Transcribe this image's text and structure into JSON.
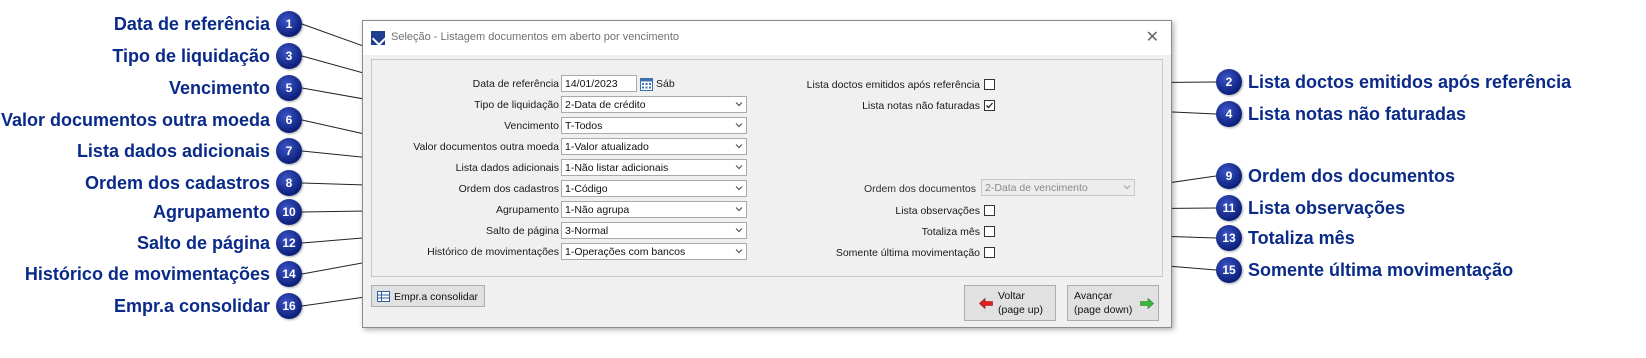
{
  "callouts": [
    {
      "num": "1",
      "text": "Data de referência"
    },
    {
      "num": "3",
      "text": "Tipo de liquidação"
    },
    {
      "num": "5",
      "text": "Vencimento"
    },
    {
      "num": "6",
      "text": "Valor documentos outra moeda"
    },
    {
      "num": "7",
      "text": "Lista dados adicionais"
    },
    {
      "num": "8",
      "text": "Ordem dos cadastros"
    },
    {
      "num": "10",
      "text": "Agrupamento"
    },
    {
      "num": "12",
      "text": "Salto de página"
    },
    {
      "num": "14",
      "text": "Histórico de movimentações"
    },
    {
      "num": "16",
      "text": "Empr.a consolidar"
    },
    {
      "num": "2",
      "text": "Lista doctos emitidos após referência"
    },
    {
      "num": "4",
      "text": "Lista notas não faturadas"
    },
    {
      "num": "9",
      "text": "Ordem dos documentos"
    },
    {
      "num": "11",
      "text": "Lista observações"
    },
    {
      "num": "13",
      "text": "Totaliza mês"
    },
    {
      "num": "15",
      "text": "Somente última movimentação"
    }
  ],
  "dialog": {
    "title": "Seleção - Listagem documentos em aberto por vencimento",
    "close_symbol": "✕"
  },
  "fields": {
    "data_referencia": {
      "label": "Data de referência",
      "value": "14/01/2023",
      "weekday": "Sáb"
    },
    "tipo_liquidacao": {
      "label": "Tipo de liquidação",
      "value": "2-Data de crédito"
    },
    "vencimento": {
      "label": "Vencimento",
      "value": "T-Todos"
    },
    "valor_outra_moeda": {
      "label": "Valor documentos outra moeda",
      "value": "1-Valor atualizado"
    },
    "lista_dados_adicionais": {
      "label": "Lista dados adicionais",
      "value": "1-Não listar adicionais"
    },
    "ordem_cadastros": {
      "label": "Ordem dos cadastros",
      "value": "1-Código"
    },
    "agrupamento": {
      "label": "Agrupamento",
      "value": "1-Não agrupa"
    },
    "salto_pagina": {
      "label": "Salto de página",
      "value": "3-Normal"
    },
    "historico_movimentacoes": {
      "label": "Histórico de movimentações",
      "value": "1-Operações com bancos"
    },
    "ordem_documentos": {
      "label": "Ordem dos documentos",
      "value": "2-Data de vencimento"
    }
  },
  "checks": {
    "lista_doctos_emitidos": {
      "label": "Lista doctos emitidos após referência",
      "checked": false
    },
    "lista_notas_nao_faturadas": {
      "label": "Lista notas não faturadas",
      "checked": true
    },
    "lista_observacoes": {
      "label": "Lista observações",
      "checked": false
    },
    "totaliza_mes": {
      "label": "Totaliza mês",
      "checked": false
    },
    "somente_ultima": {
      "label": "Somente última movimentação",
      "checked": false
    }
  },
  "buttons": {
    "empr_consolidar": "Empr.a consolidar",
    "voltar_line1": "Voltar",
    "voltar_line2": "(page up)",
    "avancar_line1": "Avançar",
    "avancar_line2": "(page down)"
  },
  "colors": {
    "callout_text": "#0a2a8a",
    "badge": "#0b1f7a",
    "leader": "#1a1a1a"
  }
}
